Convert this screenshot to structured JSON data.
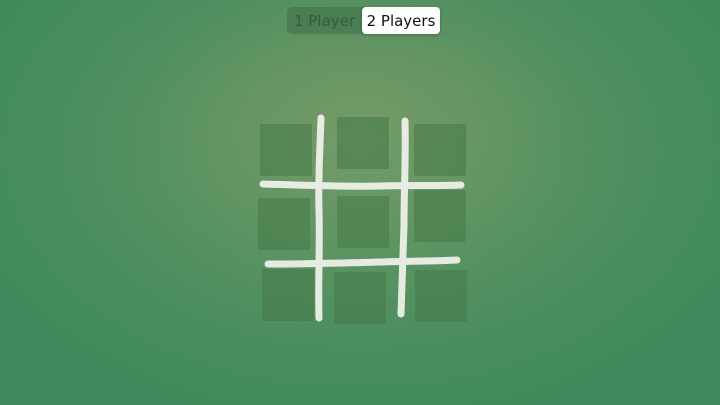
{
  "mode_selector": {
    "options": [
      {
        "label": "1 Player",
        "selected": false
      },
      {
        "label": "2 Players",
        "selected": true
      }
    ]
  },
  "board": {
    "size": 3,
    "cells": [
      "",
      "",
      "",
      "",
      "",
      "",
      "",
      "",
      ""
    ]
  },
  "colors": {
    "background": "#4a8d5f",
    "chalk": "#eef0e8",
    "cell": "#467848",
    "selected_segment": "#ffffff"
  }
}
